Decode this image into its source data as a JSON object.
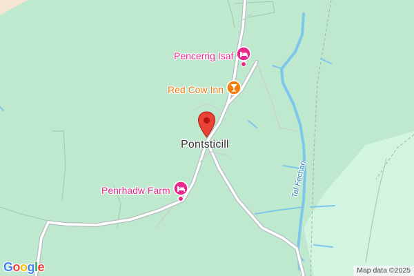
{
  "map": {
    "background": "#bfe9cf",
    "colors": {
      "land": "#bfe9cf",
      "light_land": "#d2f5e1",
      "water": "#7fc6eb",
      "road": "#ffffff",
      "road_casing": "#b5bdbf",
      "lodging_pink": "#e8288d",
      "food_orange": "#f07c0f",
      "pin_red": "#ea4335"
    }
  },
  "place": {
    "name": "Pontsticill"
  },
  "pois": [
    {
      "name": "Pencerrig Isaf",
      "category": "lodging",
      "icon": "bed-icon",
      "color": "#e8288d"
    },
    {
      "name": "Red Cow Inn",
      "category": "bar",
      "icon": "cocktail-icon",
      "color": "#f07c0f"
    },
    {
      "name": "Penrhadw Farm",
      "category": "lodging",
      "icon": "bed-icon",
      "color": "#e8288d"
    }
  ],
  "river": {
    "name": "Taf Fechan"
  },
  "marker": {
    "icon": "map-pin-icon",
    "color": "#ea4335"
  },
  "logo": {
    "letters": [
      "G",
      "o",
      "o",
      "g",
      "l",
      "e"
    ],
    "colors": [
      "#4285f4",
      "#ea4335",
      "#fbbc05",
      "#4285f4",
      "#34a853",
      "#ea4335"
    ]
  },
  "attribution": {
    "text": "Map data ©2025"
  }
}
